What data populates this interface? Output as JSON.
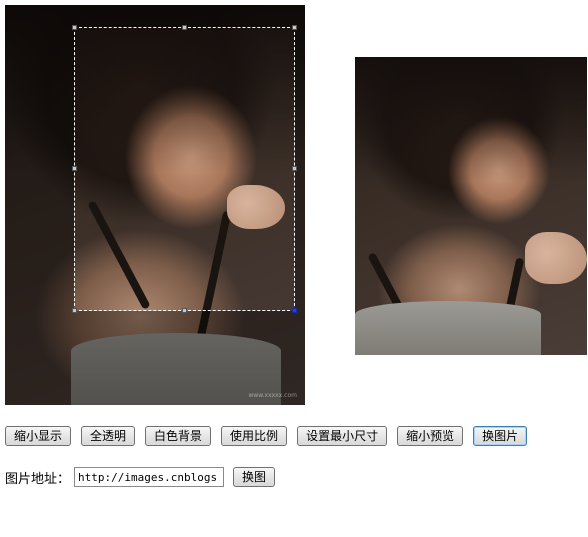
{
  "source_image": {
    "watermark": "www.xxxxx.com"
  },
  "toolbar": {
    "buttons": [
      {
        "label": "缩小显示"
      },
      {
        "label": "全透明"
      },
      {
        "label": "白色背景"
      },
      {
        "label": "使用比例"
      },
      {
        "label": "设置最小尺寸"
      },
      {
        "label": "缩小预览"
      },
      {
        "label": "换图片"
      }
    ]
  },
  "url_form": {
    "label": "图片地址：",
    "value": "http://images.cnblogs",
    "button_label": "换图"
  }
}
